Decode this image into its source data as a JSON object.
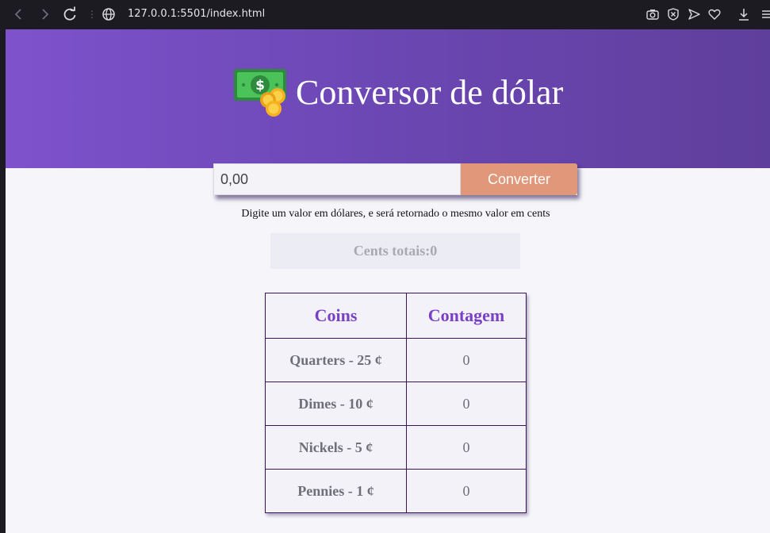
{
  "browser": {
    "url": "127.0.0.1:5501/index.html",
    "separator": "⋮"
  },
  "header": {
    "title": "Conversor de dólar",
    "icon": "money-bill-coins-icon",
    "gradient_colors": [
      "#7e52cc",
      "#5f3f9c"
    ]
  },
  "converter": {
    "input_placeholder": "0,00",
    "input_value": "",
    "button_label": "Converter",
    "button_color": "#e0977a",
    "hint": "Digite um valor em dólares, e será retornado o mesmo valor em cents"
  },
  "total": {
    "label": "Cents totais:0"
  },
  "table": {
    "headers": [
      "Coins",
      "Contagem"
    ],
    "rows": [
      {
        "coin": "Quarters - 25 ¢",
        "count": "0"
      },
      {
        "coin": "Dimes - 10 ¢",
        "count": "0"
      },
      {
        "coin": "Nickels - 5 ¢",
        "count": "0"
      },
      {
        "coin": "Pennies - 1 ¢",
        "count": "0"
      }
    ],
    "header_color": "#7a3fc7"
  }
}
